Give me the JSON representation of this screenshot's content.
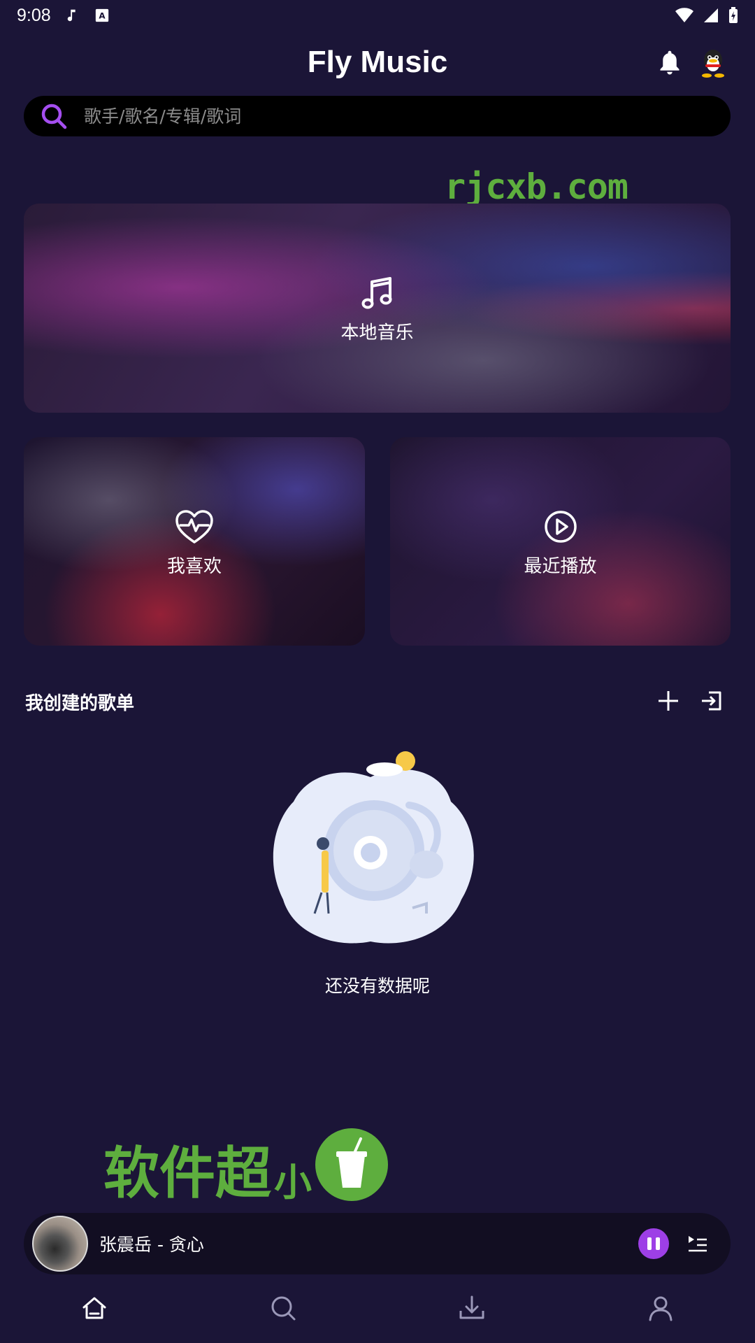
{
  "status_bar": {
    "time": "9:08"
  },
  "header": {
    "title": "Fly Music"
  },
  "search": {
    "placeholder": "歌手/歌名/专辑/歌词"
  },
  "watermark": {
    "top": "rjcxb.com",
    "bottom_large": "软件超",
    "bottom_small": "小"
  },
  "cards": {
    "local": "本地音乐",
    "favorite": "我喜欢",
    "recent": "最近播放"
  },
  "playlist_section": {
    "title": "我创建的歌单",
    "empty_text": "还没有数据呢"
  },
  "player": {
    "song": "张震岳 - 贪心",
    "state": "playing"
  },
  "colors": {
    "background": "#1b1537",
    "accent": "#9d3fe6",
    "watermark": "#5eae3e"
  },
  "bottom_nav": {
    "items": [
      "home-icon",
      "search-icon",
      "download-icon",
      "profile-icon"
    ]
  }
}
